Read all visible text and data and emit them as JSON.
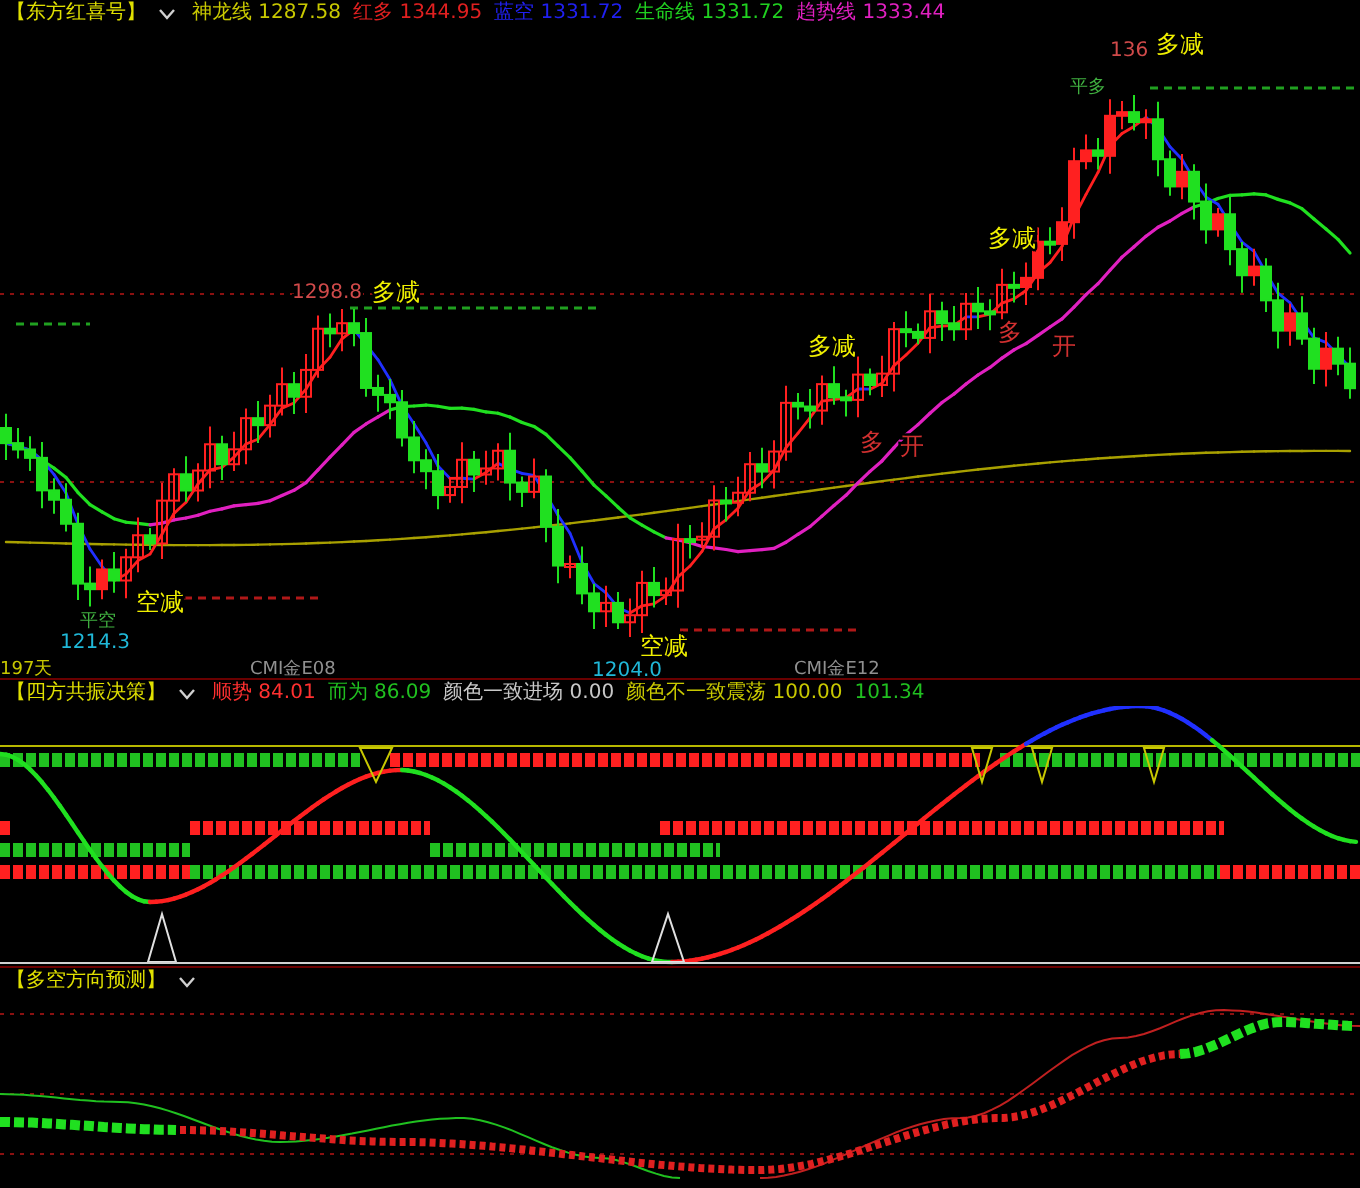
{
  "main_panel": {
    "title": "【东方红喜号】",
    "indicators": [
      {
        "label": "神龙线",
        "value": "1287.58",
        "color": "#c8c800"
      },
      {
        "label": "红多",
        "value": "1344.95",
        "color": "#e02020"
      },
      {
        "label": "蓝空",
        "value": "1331.72",
        "color": "#2020f0"
      },
      {
        "label": "生命线",
        "value": "1331.72",
        "color": "#20d020"
      },
      {
        "label": "趋势线",
        "value": "1333.44",
        "color": "#e020c0"
      }
    ],
    "annotations": [
      {
        "kind": "high",
        "text": "136"
      },
      {
        "kind": "signal",
        "text": "多减"
      },
      {
        "kind": "close",
        "text": "平多"
      },
      {
        "kind": "high",
        "text": "1298.8"
      },
      {
        "kind": "signal",
        "text": "多减"
      },
      {
        "kind": "signal",
        "text": "多减"
      },
      {
        "kind": "signal",
        "text": "多减"
      },
      {
        "kind": "open",
        "text": "多"
      },
      {
        "kind": "open",
        "text": "开"
      },
      {
        "kind": "open",
        "text": "多"
      },
      {
        "kind": "open",
        "text": "开"
      },
      {
        "kind": "signal",
        "text": "空减"
      },
      {
        "kind": "close",
        "text": "平空"
      },
      {
        "kind": "low",
        "text": "1214.3"
      },
      {
        "kind": "signal",
        "text": "空减"
      },
      {
        "kind": "low",
        "text": "1204.0"
      }
    ],
    "footer": [
      {
        "kind": "days",
        "text": "197天"
      },
      {
        "kind": "marker",
        "text": "CMI金E08"
      },
      {
        "kind": "marker",
        "text": "CMI金E12"
      }
    ]
  },
  "resonance_panel": {
    "title": "【四方共振决策】",
    "indicators": [
      {
        "label": "顺势",
        "value": "84.01",
        "color": "#ff3030"
      },
      {
        "label": "而为",
        "value": "86.09",
        "color": "#20c020"
      },
      {
        "label": "颜色一致进场",
        "value": "0.00",
        "color": "#c8c8c8"
      },
      {
        "label": "颜色不一致震荡",
        "value": "100.00",
        "color": "#c8c800"
      },
      {
        "value": "101.34",
        "color": "#20c020"
      }
    ]
  },
  "forecast_panel": {
    "title": "【多空方向预测】"
  }
}
